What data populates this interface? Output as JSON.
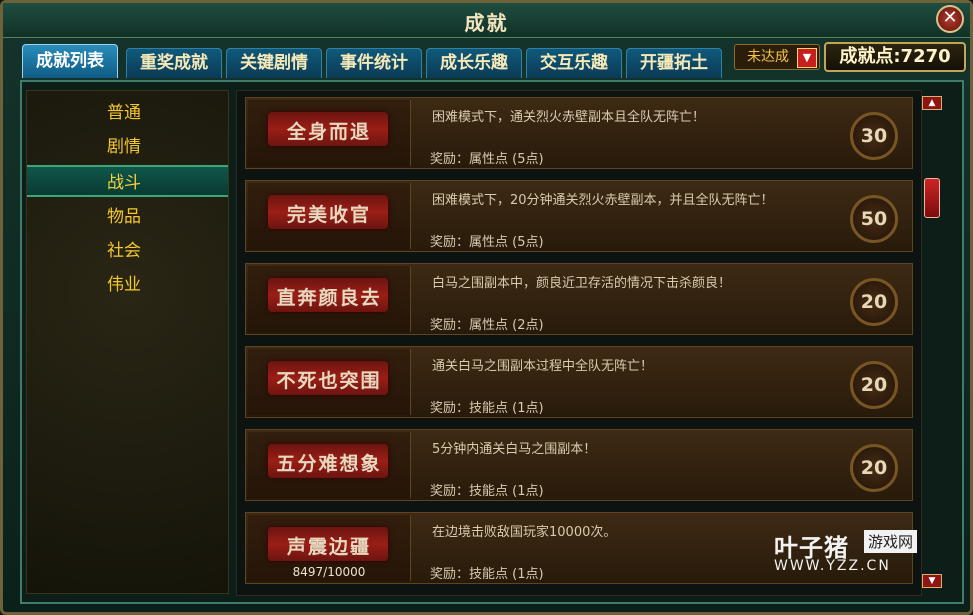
{
  "window": {
    "title": "成就",
    "close_label": "✕"
  },
  "tabs": [
    {
      "label": "成就列表",
      "active": true
    },
    {
      "label": "重奖成就"
    },
    {
      "label": "关键剧情"
    },
    {
      "label": "事件统计"
    },
    {
      "label": "成长乐趣"
    },
    {
      "label": "交互乐趣"
    },
    {
      "label": "开疆拓土"
    }
  ],
  "filter": {
    "label": "未达成"
  },
  "achievement_points": "成就点:7270",
  "categories": [
    {
      "label": "普通"
    },
    {
      "label": "剧情"
    },
    {
      "label": "战斗",
      "active": true
    },
    {
      "label": "物品"
    },
    {
      "label": "社会"
    },
    {
      "label": "伟业"
    }
  ],
  "achievements": [
    {
      "name": "全身而退",
      "desc": "困难模式下，通关烈火赤壁副本且全队无阵亡！",
      "reward": "奖励：属性点 (5点)",
      "points": "30"
    },
    {
      "name": "完美收官",
      "desc": "困难模式下，20分钟通关烈火赤壁副本，并且全队无阵亡！",
      "reward": "奖励：属性点 (5点)",
      "points": "50"
    },
    {
      "name": "直奔颜良去",
      "desc": "白马之围副本中，颜良近卫存活的情况下击杀颜良！",
      "reward": "奖励：属性点 (2点)",
      "points": "20"
    },
    {
      "name": "不死也突围",
      "desc": "通关白马之围副本过程中全队无阵亡！",
      "reward": "奖励：技能点 (1点)",
      "points": "20"
    },
    {
      "name": "五分难想象",
      "desc": "5分钟内通关白马之围副本！",
      "reward": "奖励：技能点 (1点)",
      "points": "20"
    },
    {
      "name": "声震边疆",
      "progress": "8497/10000",
      "desc": "在边境击败敌国玩家10000次。",
      "reward": "奖励：技能点 (1点)",
      "points": ""
    }
  ],
  "scrollbar": {
    "up": "▲",
    "down": "▼",
    "position": 0.2
  },
  "watermark": {
    "brand": "叶子猪",
    "tag": "游戏网",
    "url": "WWW.YZZ.CN"
  },
  "colors": {
    "accent_gold": "#f5c72c",
    "tab_blue": "#0f5c84",
    "row_brown": "#3e2a14",
    "badge_red": "#c81e1e"
  }
}
